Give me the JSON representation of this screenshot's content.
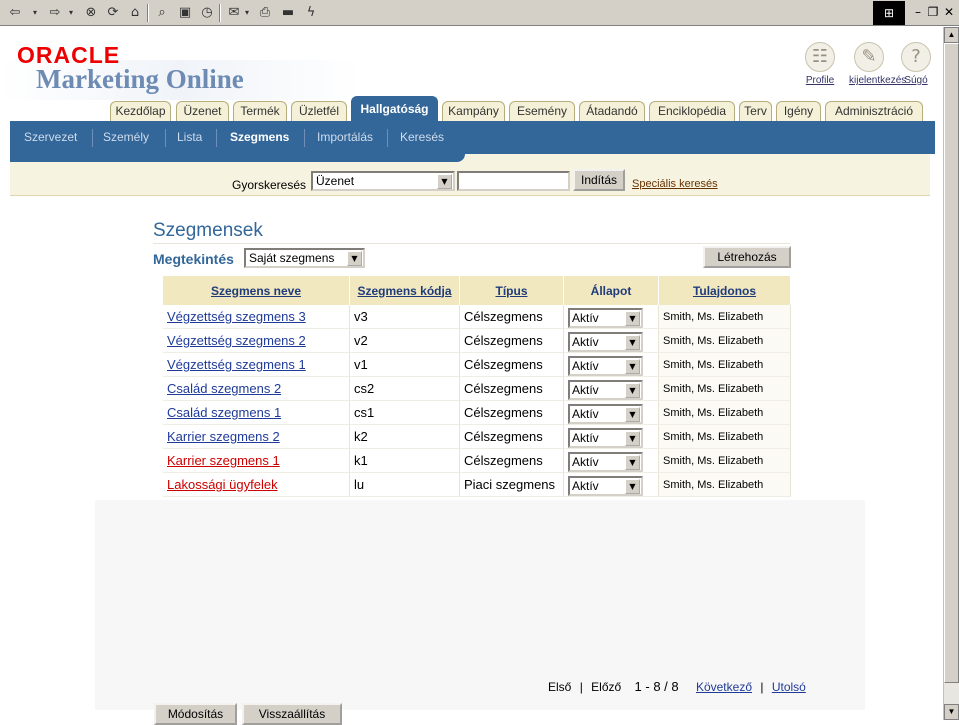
{
  "browser": {
    "toolbar_icons": [
      "back-icon",
      "forward-icon",
      "stop-icon",
      "refresh-icon",
      "home-icon",
      "search-icon",
      "favorites-icon",
      "history-icon",
      "mail-icon",
      "print-icon",
      "edit-icon",
      "messenger-icon"
    ],
    "window_controls": [
      "minimize-icon",
      "restore-icon",
      "close-icon"
    ]
  },
  "app": {
    "logo_brand": "ORACLE",
    "logo_title": "Marketing Online"
  },
  "global_links": [
    {
      "label": "Profile",
      "icon": "profile-icon"
    },
    {
      "label": "kijelentkezés",
      "icon": "logout-icon"
    },
    {
      "label": "Súgó",
      "icon": "help-icon"
    }
  ],
  "tabs": [
    "Kezdőlap",
    "Üzenet",
    "Termék",
    "Üzletfél",
    "Hallgatóság",
    "Kampány",
    "Esemény",
    "Átadandó",
    "Enciklopédia",
    "Terv",
    "Igény",
    "Adminisztráció"
  ],
  "active_tab": "Hallgatóság",
  "subnav": [
    "Szervezet",
    "Személy",
    "Lista",
    "Szegmens",
    "Importálás",
    "Keresés"
  ],
  "active_subnav": "Szegmens",
  "quick_search": {
    "label": "Gyorskeresés",
    "selected": "Üzenet",
    "input_value": "",
    "go_label": "Indítás",
    "advanced_label": "Speciális keresés"
  },
  "page": {
    "title": "Szegmensek",
    "view_label": "Megtekintés",
    "view_selected": "Saját szegmens",
    "create_label": "Létrehozás"
  },
  "table": {
    "columns": [
      "Szegmens neve",
      "Szegmens kódja",
      "Típus",
      "Állapot",
      "Tulajdonos"
    ],
    "rows": [
      {
        "name": "Végzettség szegmens 3",
        "code": "v3",
        "type": "Célszegmens",
        "status": "Aktív",
        "owner": "Smith, Ms. Elizabeth",
        "visited": false
      },
      {
        "name": "Végzettség szegmens 2",
        "code": "v2",
        "type": "Célszegmens",
        "status": "Aktív",
        "owner": "Smith, Ms. Elizabeth",
        "visited": false
      },
      {
        "name": "Végzettség szegmens 1",
        "code": "v1",
        "type": "Célszegmens",
        "status": "Aktív",
        "owner": "Smith, Ms. Elizabeth",
        "visited": false
      },
      {
        "name": "Család szegmens 2",
        "code": "cs2",
        "type": "Célszegmens",
        "status": "Aktív",
        "owner": "Smith, Ms. Elizabeth",
        "visited": false
      },
      {
        "name": "Család szegmens 1",
        "code": "cs1",
        "type": "Célszegmens",
        "status": "Aktív",
        "owner": "Smith, Ms. Elizabeth",
        "visited": false
      },
      {
        "name": "Karrier szegmens 2",
        "code": "k2",
        "type": "Célszegmens",
        "status": "Aktív",
        "owner": "Smith, Ms. Elizabeth",
        "visited": false
      },
      {
        "name": "Karrier szegmens 1",
        "code": "k1",
        "type": "Célszegmens",
        "status": "Aktív",
        "owner": "Smith, Ms. Elizabeth",
        "visited": true
      },
      {
        "name": "Lakossági ügyfelek",
        "code": "lu",
        "type": "Piaci szegmens",
        "status": "Aktív",
        "owner": "Smith, Ms. Elizabeth",
        "visited": true
      }
    ]
  },
  "pager": {
    "first": "Első",
    "previous": "Előző",
    "range": "1 - 8 / 8",
    "next": "Következő",
    "last": "Utolsó"
  },
  "actions": {
    "modify": "Módosítás",
    "reset": "Visszaállítás"
  }
}
